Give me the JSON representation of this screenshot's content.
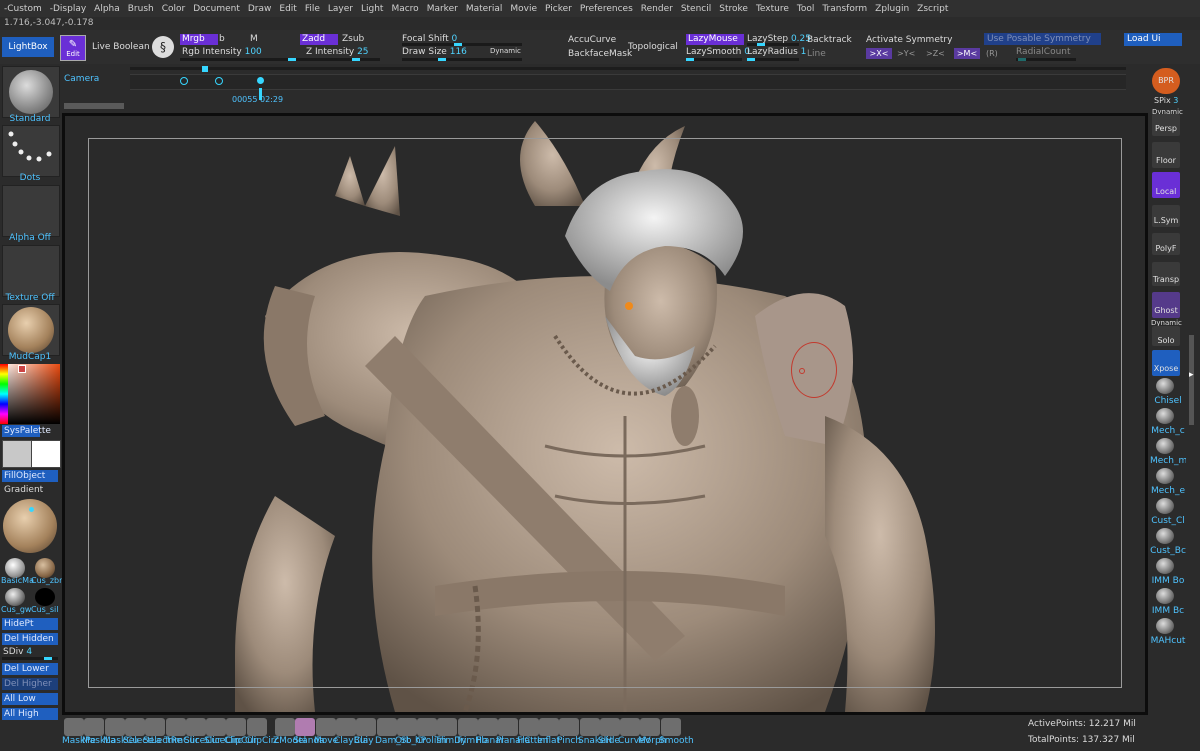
{
  "menu": [
    "-Custom",
    "-Display",
    "Alpha",
    "Brush",
    "Color",
    "Document",
    "Draw",
    "Edit",
    "File",
    "Layer",
    "Light",
    "Macro",
    "Marker",
    "Material",
    "Movie",
    "Picker",
    "Preferences",
    "Render",
    "Stencil",
    "Stroke",
    "Texture",
    "Tool",
    "Transform",
    "Zplugin",
    "Zscript"
  ],
  "coords": "1.716,-3.047,-0.178",
  "shelf": {
    "lightbox": "LightBox",
    "edit": "Edit",
    "live_boolean": "Live Boolean",
    "mrgb": "Mrgb",
    "rgb": "b",
    "m": "M",
    "rgb_intensity_label": "Rgb Intensity",
    "rgb_intensity": "100",
    "zadd": "Zadd",
    "zsub": "Zsub",
    "z_intensity_label": "Z Intensity",
    "z_intensity": "25",
    "focal_shift_label": "Focal Shift",
    "focal_shift": "0",
    "draw_size_label": "Draw Size",
    "draw_size": "116",
    "dynamic": "Dynamic",
    "accucurve": "AccuCurve",
    "backfacemask": "BackfaceMask",
    "topological": "Topological",
    "lazymouse": "LazyMouse",
    "lazysmooth_label": "LazySmooth",
    "lazysmooth": "0",
    "lazystep_label": "LazyStep",
    "lazystep": "0.25",
    "lazyradius_label": "LazyRadius",
    "lazyradius": "1",
    "backtrack": "Backtrack",
    "line": "Line",
    "activate_symmetry": "Activate Symmetry",
    "sym_x": ">X<",
    "sym_y": ">Y<",
    "sym_z": ">Z<",
    "sym_m": ">M<",
    "sym_r": "(R)",
    "use_posable": "Use Posable Symmetry",
    "radialcount": "RadialCount",
    "load_ui": "Load Ui"
  },
  "timeline": {
    "label": "Camera",
    "time": "00055 02:29"
  },
  "left": {
    "brush": "Standard",
    "stroke": "Dots",
    "alpha": "Alpha Off",
    "texture": "Texture Off",
    "material": "MudCap1",
    "syspalette": "SysPalette",
    "fillobject": "FillObject",
    "gradient": "Gradient",
    "mat_a": "BasicMa",
    "mat_b": "Cus_zbr",
    "mat_c": "Cus_gw",
    "mat_d": "Cus_sil",
    "hidept": "HidePt",
    "del_hidden": "Del Hidden",
    "sdiv_label": "SDiv",
    "sdiv": "4",
    "del_lower": "Del Lower",
    "del_higher": "Del Higher",
    "all_low": "All Low",
    "all_high": "All High"
  },
  "right": {
    "bpr": "BPR",
    "spix_label": "SPix",
    "spix": "3",
    "dynamic": "Dynamic",
    "persp": "Persp",
    "floor": "Floor",
    "local": "Local",
    "lsym": "L.Sym",
    "polyf": "PolyF",
    "transp": "Transp",
    "ghost": "Ghost",
    "solo": "Solo",
    "xpose": "Xpose",
    "brushes": [
      "Chisel",
      "Mech_c",
      "Mech_m",
      "Mech_e",
      "Cust_Cl",
      "Cust_Bc",
      "IMM Bo",
      "IMM Bc",
      "MAHcut"
    ]
  },
  "bottom": {
    "brushes": [
      "MaskPe",
      "MaskLa",
      "MaskCu",
      "SelectLa",
      "SelectRe",
      "TrimCur",
      "SliceCur",
      "SliceCirc",
      "ClipCur",
      "ClipCirc",
      "ZModel",
      "Standa",
      "Move",
      "ClayBui",
      "Clay",
      "Dam_St",
      "Orb_Cr",
      "hPolish",
      "TrimDy",
      "TrimHo",
      "Planar",
      "PlanarC",
      "Flatten",
      "Inflat",
      "Pinch",
      "SnakeH",
      "Slide",
      "CurveV",
      "Morph",
      "Smooth"
    ],
    "active_points": "ActivePoints: 12.217 Mil",
    "total_points": "TotalPoints: 137.327 Mil"
  },
  "colors": {
    "accent": "#36d6ff",
    "blue_button": "#1f5fbf",
    "purple_button": "#6a2fd6",
    "clay": "#b8a898"
  }
}
